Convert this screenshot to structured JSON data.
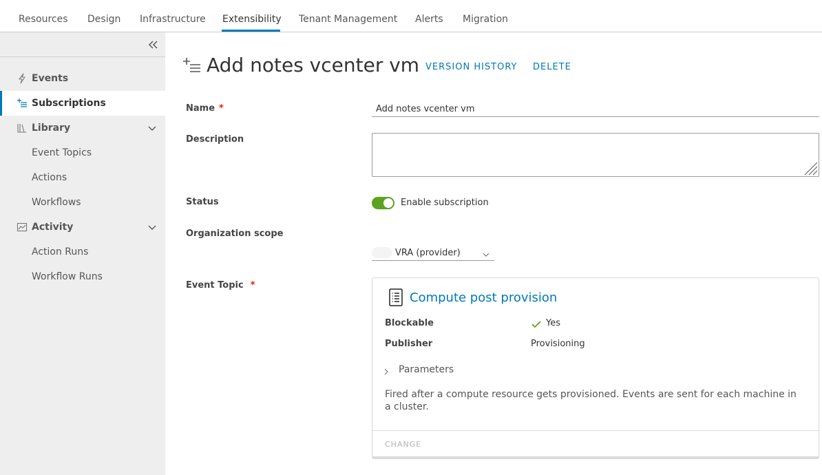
{
  "topnav": {
    "tabs": [
      {
        "label": "Resources"
      },
      {
        "label": "Design"
      },
      {
        "label": "Infrastructure"
      },
      {
        "label": "Extensibility",
        "active": true
      },
      {
        "label": "Tenant Management"
      },
      {
        "label": "Alerts"
      },
      {
        "label": "Migration"
      }
    ]
  },
  "sidebar": {
    "collapse_icon": "double-chevron-left-icon",
    "items": [
      {
        "label": "Events",
        "icon": "lightning-icon"
      },
      {
        "label": "Subscriptions",
        "icon": "subscription-list-icon",
        "active": true
      },
      {
        "label": "Library",
        "icon": "library-icon",
        "expanded": true,
        "children": [
          "Event Topics",
          "Actions",
          "Workflows"
        ]
      },
      {
        "label": "Activity",
        "icon": "activity-chart-icon",
        "expanded": true,
        "children": [
          "Action Runs",
          "Workflow Runs"
        ]
      }
    ]
  },
  "page": {
    "title": "Add notes vcenter vm",
    "title_icon": "subscription-list-icon",
    "actions": {
      "version_history": "VERSION HISTORY",
      "delete": "DELETE"
    }
  },
  "form": {
    "name": {
      "label": "Name",
      "required": "*",
      "value": "Add notes vcenter vm"
    },
    "description": {
      "label": "Description",
      "value": ""
    },
    "status": {
      "label": "Status",
      "toggle_on": true,
      "toggle_label": "Enable subscription"
    },
    "org_scope": {
      "label": "Organization scope",
      "value": "VRA (provider)"
    },
    "event_topic": {
      "label": "Event Topic",
      "required": "*",
      "card": {
        "icon": "document-list-icon",
        "title": "Compute post provision",
        "blockable_label": "Blockable",
        "blockable_value": "Yes",
        "publisher_label": "Publisher",
        "publisher_value": "Provisioning",
        "parameters_label": "Parameters",
        "description": "Fired after a compute resource gets provisioned. Events are sent for each machine in a cluster.",
        "change_label": "CHANGE"
      }
    }
  },
  "colors": {
    "accent": "#0079b8",
    "toggle_on": "#5aa220",
    "required": "#e12200",
    "sidebar_bg": "#eeeeee"
  }
}
